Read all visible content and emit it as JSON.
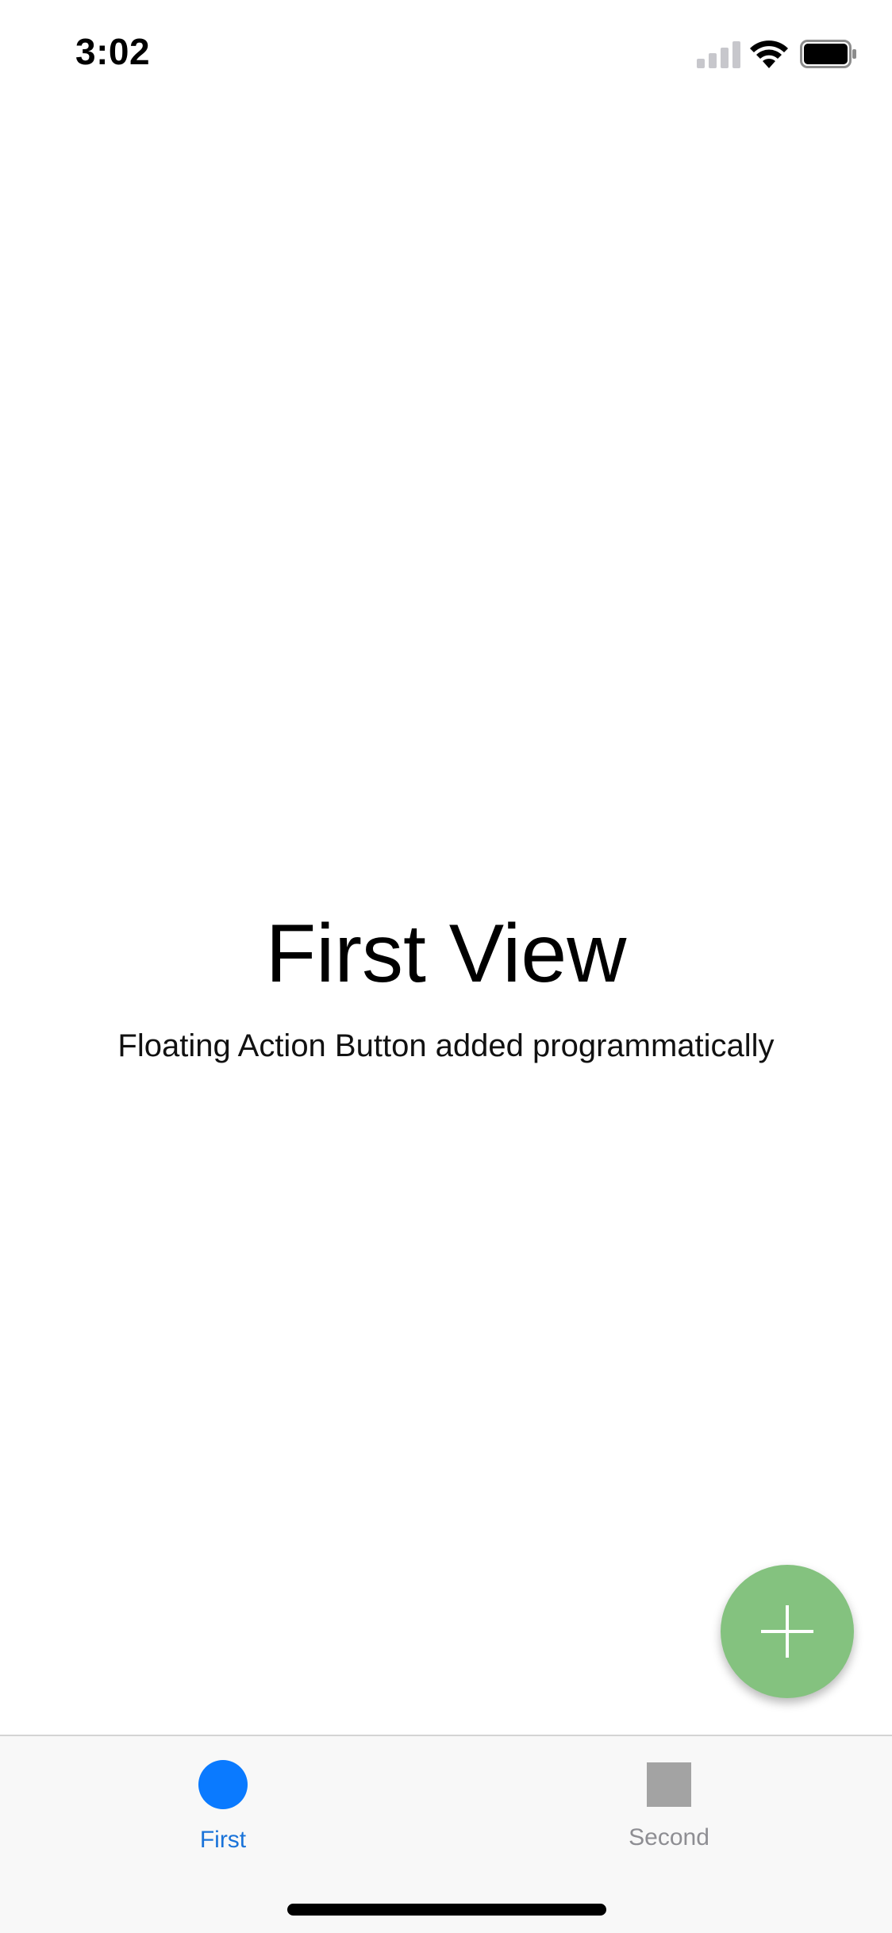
{
  "status_bar": {
    "time": "3:02",
    "signal_icon": "cellular-signal-icon",
    "wifi_icon": "wifi-icon",
    "battery_icon": "battery-icon"
  },
  "main": {
    "title": "First View",
    "subtitle": "Floating Action Button added programmatically"
  },
  "fab": {
    "icon": "plus-icon",
    "color": "#84c27f"
  },
  "tab_bar": {
    "tabs": [
      {
        "label": "First",
        "icon": "circle-icon",
        "selected": true,
        "color": "#0a7aff",
        "label_color": "#1a73d9"
      },
      {
        "label": "Second",
        "icon": "square-icon",
        "selected": false,
        "color": "#a3a3a3",
        "label_color": "#8e8e93"
      }
    ]
  }
}
